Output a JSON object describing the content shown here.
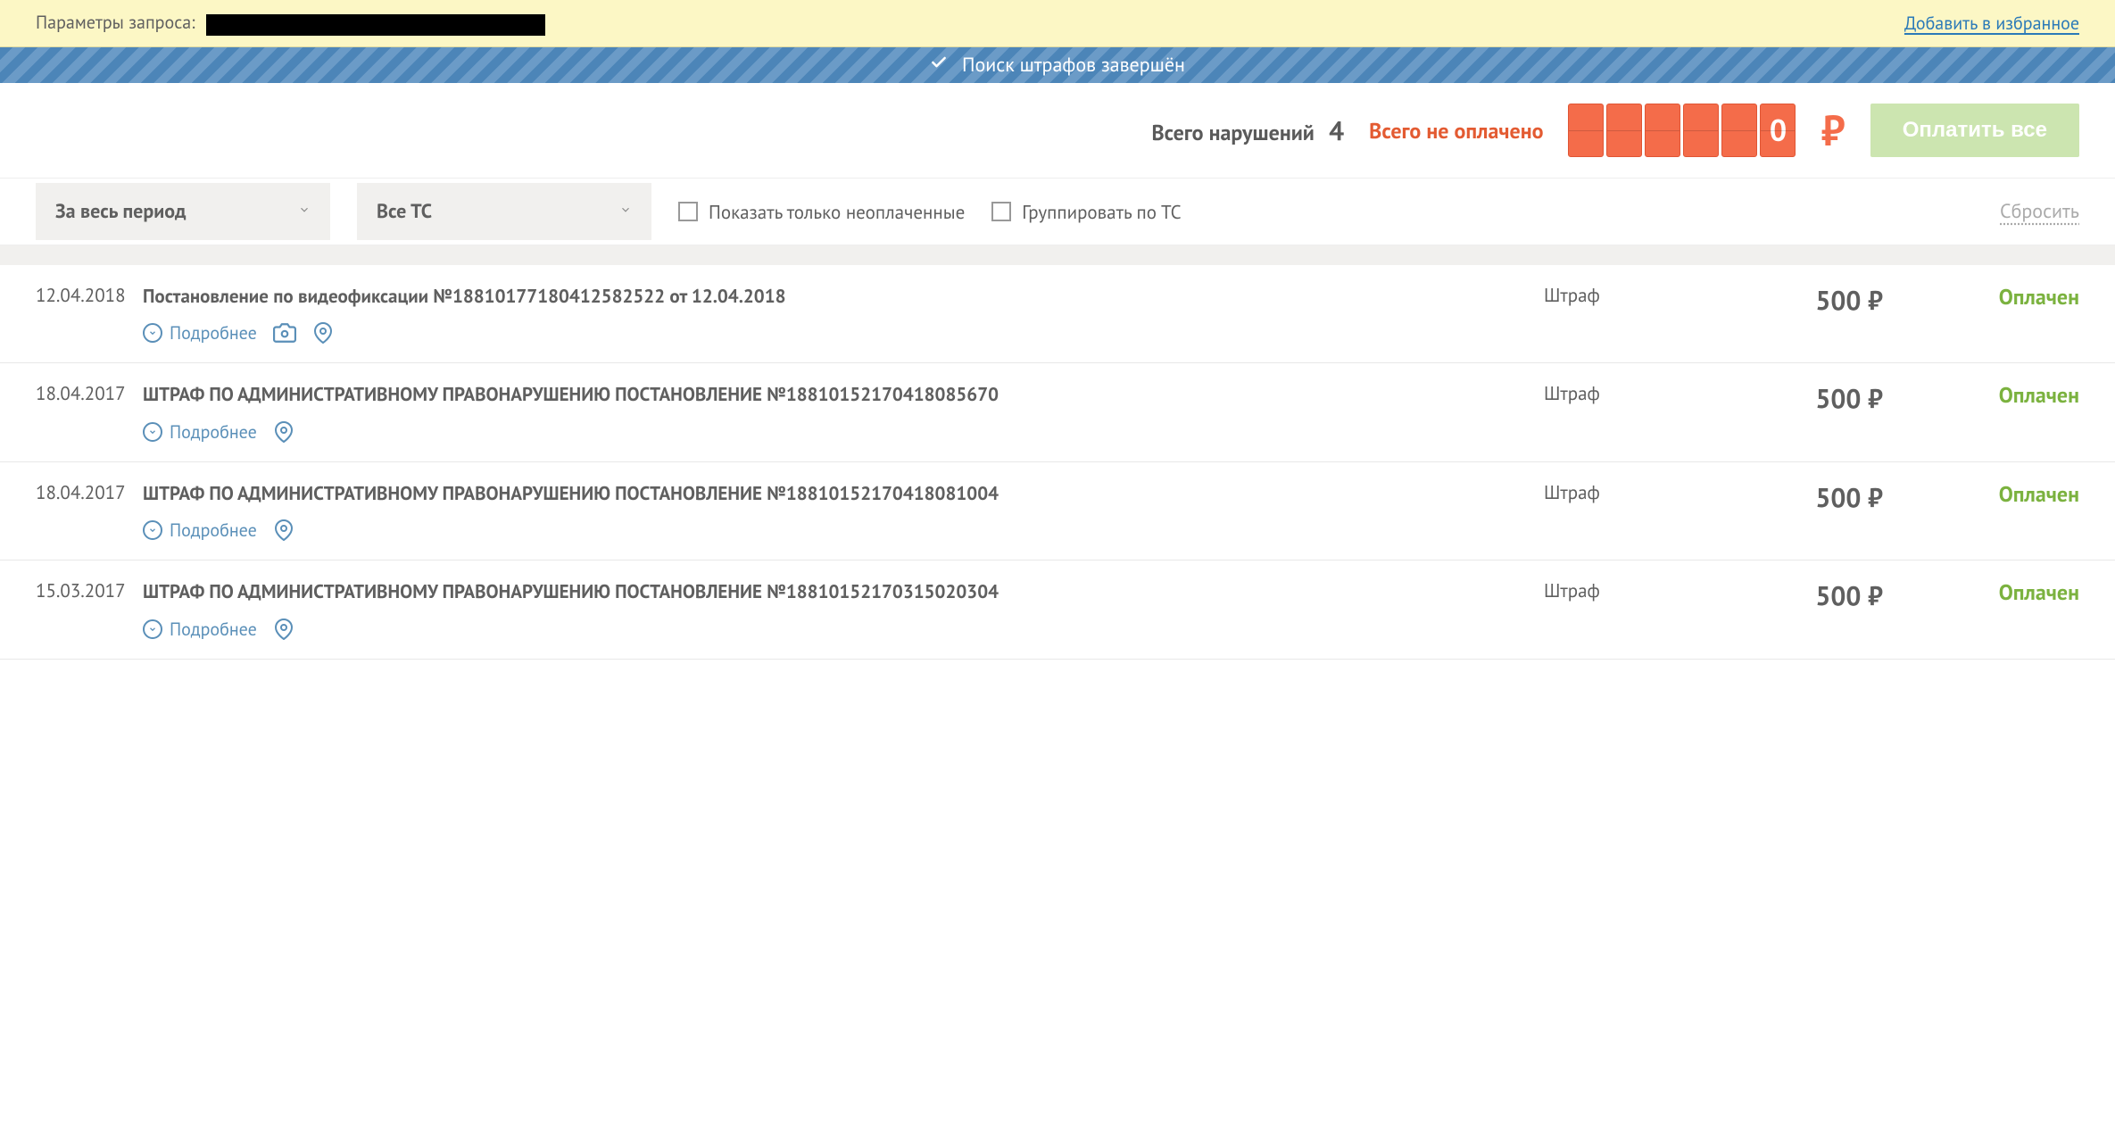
{
  "topbar": {
    "params_label": "Параметры запроса:",
    "favorite_link": "Добавить в избранное"
  },
  "progress": {
    "text": "Поиск штрафов завершён"
  },
  "summary": {
    "violations_label": "Всего нарушений",
    "violations_count": "4",
    "unpaid_label": "Всего не оплачено",
    "unpaid_amount": "0",
    "currency": "₽",
    "pay_all_btn": "Оплатить все"
  },
  "filters": {
    "period": "За весь период",
    "vehicle": "Все ТС",
    "show_unpaid": "Показать только неоплаченные",
    "group_by_vehicle": "Группировать по ТС",
    "reset": "Сбросить"
  },
  "fines": [
    {
      "date": "12.04.2018",
      "title": "Постановление по видеофиксации №18810177180412582522 от 12.04.2018",
      "type": "Штраф",
      "amount": "500 ₽",
      "status": "Оплачен",
      "details": "Подробнее",
      "has_camera": true,
      "has_location": true
    },
    {
      "date": "18.04.2017",
      "title": "ШТРАФ ПО АДМИНИСТРАТИВНОМУ ПРАВОНАРУШЕНИЮ ПОСТАНОВЛЕНИЕ №18810152170418085670",
      "type": "Штраф",
      "amount": "500 ₽",
      "status": "Оплачен",
      "details": "Подробнее",
      "has_camera": false,
      "has_location": true
    },
    {
      "date": "18.04.2017",
      "title": "ШТРАФ ПО АДМИНИСТРАТИВНОМУ ПРАВОНАРУШЕНИЮ ПОСТАНОВЛЕНИЕ №18810152170418081004",
      "type": "Штраф",
      "amount": "500 ₽",
      "status": "Оплачен",
      "details": "Подробнее",
      "has_camera": false,
      "has_location": true
    },
    {
      "date": "15.03.2017",
      "title": "ШТРАФ ПО АДМИНИСТРАТИВНОМУ ПРАВОНАРУШЕНИЮ ПОСТАНОВЛЕНИЕ №18810152170315020304",
      "type": "Штраф",
      "amount": "500 ₽",
      "status": "Оплачен",
      "details": "Подробнее",
      "has_camera": false,
      "has_location": true
    }
  ]
}
